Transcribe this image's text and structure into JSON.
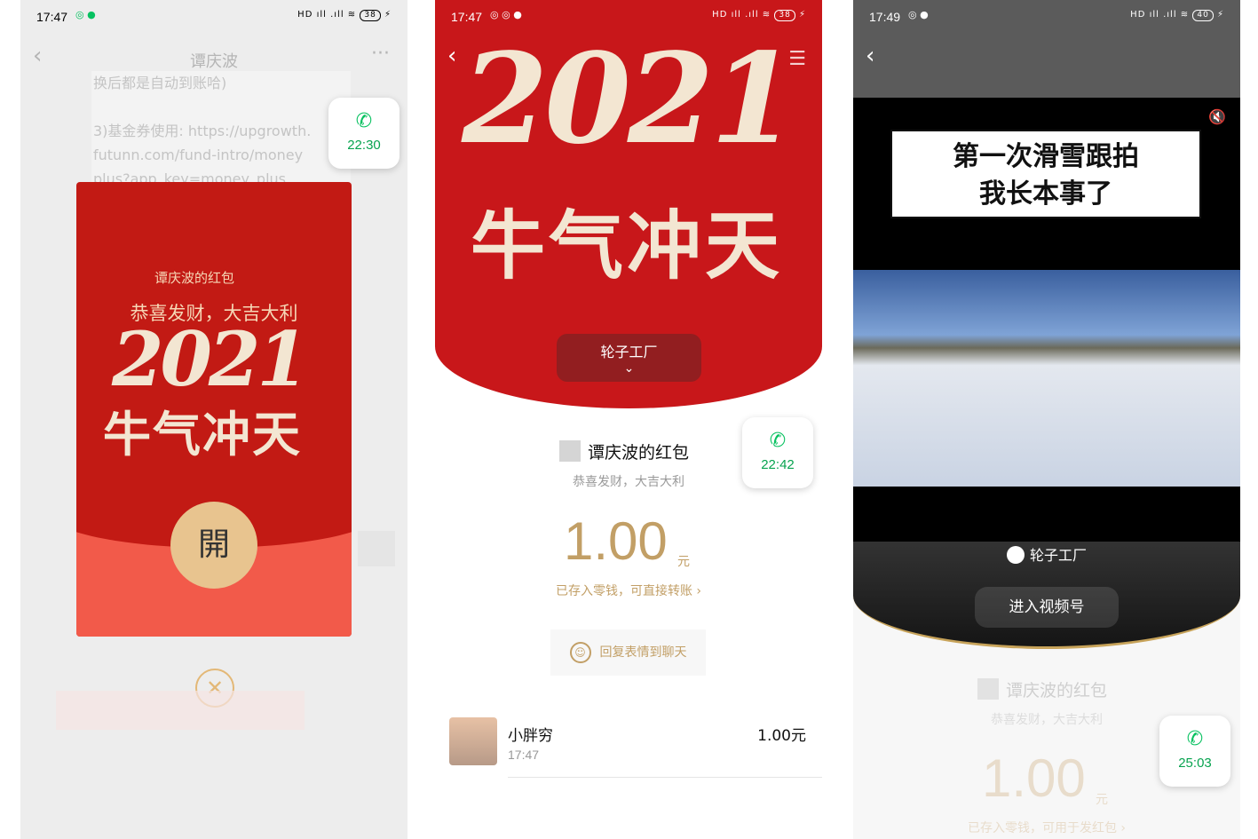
{
  "phone1": {
    "status_time": "17:47",
    "status_apps": "◎ ●",
    "status_right": "HD ıll .ıll ≋",
    "battery": "38",
    "chat_title": "谭庆波",
    "more": "···",
    "bubble_lines": [
      "换后都是自动到账哈)",
      "",
      "3)基金券使用: https://upgrowth.",
      "futunn.com/fund-intro/money",
      "plus?app_key=money_plus"
    ],
    "call_time": "22:30",
    "envelope_sender": "谭庆波的红包",
    "envelope_wish": "恭喜发财，大吉大利",
    "year_art": "2021",
    "slogan_art": "牛气冲天",
    "open_label": "開",
    "close_icon": "✕"
  },
  "phone2": {
    "status_time": "17:47",
    "status_apps": "◎ ◎ ●",
    "status_right": "HD ıll .ıll ≋",
    "battery": "38",
    "year_art": "2021",
    "slogan_art": "牛气冲天",
    "channel_name": "轮子工厂",
    "channel_chevron": "⌄",
    "call_time": "22:42",
    "sender": "谭庆波的红包",
    "wish": "恭喜发财，大吉大利",
    "amount": "1.00",
    "unit": "元",
    "note": "已存入零钱，可直接转账 ›",
    "reply_label": "回复表情到聊天",
    "receiver": {
      "name": "小胖穷",
      "time": "17:47",
      "amount": "1.00元"
    }
  },
  "phone3": {
    "status_time": "17:49",
    "status_apps": "◎ ●",
    "status_right": "HD ıll .ıll ≋",
    "battery": "40",
    "mute_icon": "🔇",
    "caption_line1": "第一次滑雪跟拍",
    "caption_line2": "我长本事了",
    "channel_name": "轮子工厂",
    "enter_label": "进入视频号",
    "sender": "谭庆波的红包",
    "wish": "恭喜发财，大吉大利",
    "amount": "1.00",
    "unit": "元",
    "note": "已存入零钱，可用于发红包 ›",
    "call_time": "25:03"
  }
}
